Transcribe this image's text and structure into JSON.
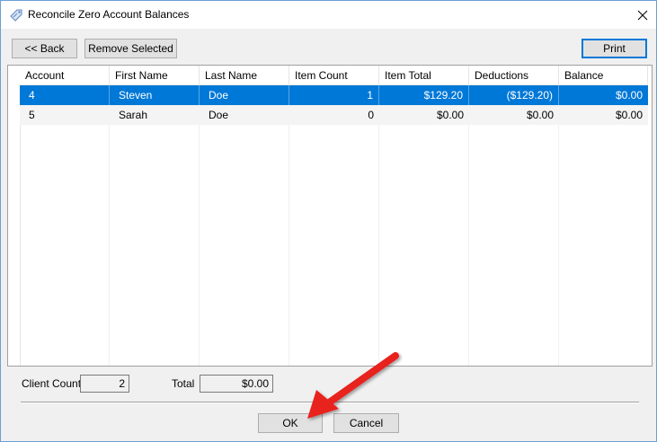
{
  "window": {
    "title": "Reconcile Zero Account Balances"
  },
  "toolbar": {
    "back_label": "<< Back",
    "remove_label": "Remove Selected",
    "print_label": "Print"
  },
  "grid": {
    "columns": [
      "Account",
      "First Name",
      "Last Name",
      "Item Count",
      "Item Total",
      "Deductions",
      "Balance"
    ],
    "rows": [
      {
        "account": "4",
        "first_name": "Steven",
        "last_name": "Doe",
        "item_count": "1",
        "item_total": "$129.20",
        "deductions": "($129.20)",
        "balance": "$0.00"
      },
      {
        "account": "5",
        "first_name": "Sarah",
        "last_name": "Doe",
        "item_count": "0",
        "item_total": "$0.00",
        "deductions": "$0.00",
        "balance": "$0.00"
      }
    ]
  },
  "footer": {
    "client_count_label": "Client Count",
    "client_count_value": "2",
    "total_label": "Total",
    "total_value": "$0.00",
    "ok_label": "OK",
    "cancel_label": "Cancel"
  },
  "colors": {
    "selection": "#0078d7",
    "arrow": "#e8201e"
  },
  "icons": {
    "app": "tag-icon",
    "close": "close-icon",
    "annotation": "red-arrow-annotation"
  }
}
